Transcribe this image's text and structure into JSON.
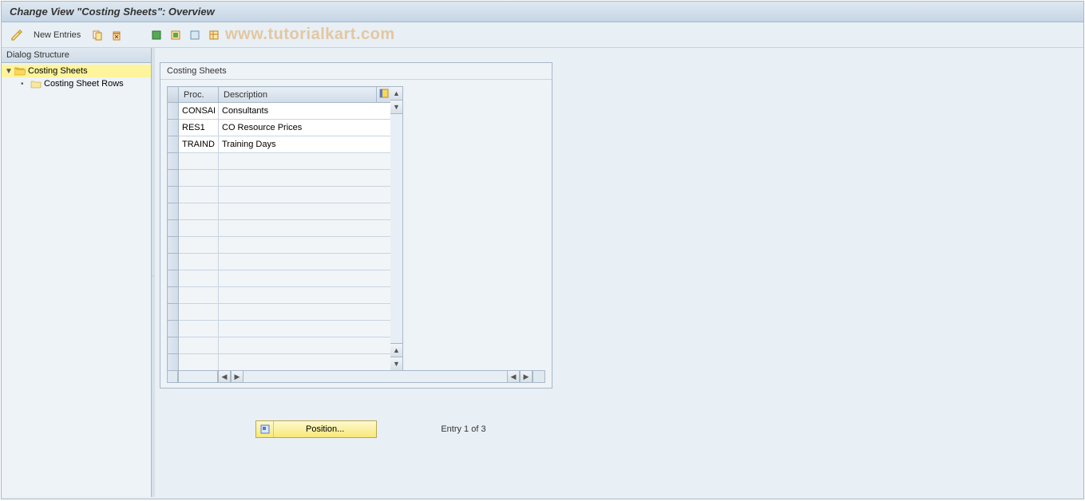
{
  "title": "Change View \"Costing Sheets\": Overview",
  "toolbar": {
    "new_entries_label": "New Entries"
  },
  "watermark": "www.tutorialkart.com",
  "sidebar": {
    "header": "Dialog Structure",
    "items": [
      {
        "label": "Costing Sheets",
        "selected": true,
        "expanded": true
      },
      {
        "label": "Costing Sheet Rows",
        "selected": false
      }
    ]
  },
  "grid": {
    "title": "Costing Sheets",
    "columns": {
      "proc": "Proc.",
      "desc": "Description"
    },
    "rows": [
      {
        "proc": "CONSAL",
        "desc": "Consultants"
      },
      {
        "proc": "RES1",
        "desc": "CO Resource Prices"
      },
      {
        "proc": "TRAIND",
        "desc": "Training Days"
      }
    ],
    "empty_row_count": 13
  },
  "footer": {
    "position_label": "Position...",
    "entry_text": "Entry 1 of 3"
  }
}
